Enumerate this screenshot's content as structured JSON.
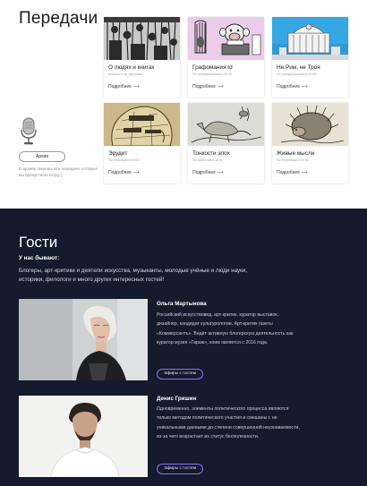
{
  "shows": {
    "title": "Передачи",
    "archive_label": "Архив",
    "archive_note": "В архиве пишешь все передачи, которые вы пропустили! Enjoy:)",
    "cards": [
      {
        "name": "О людях и книгах",
        "meta": "Анонсы и пр. выпусков",
        "more": "Подробнее ⟶",
        "icon": "crowd-engraving"
      },
      {
        "name": "Графомания td",
        "meta": "По понедельникам в 20:00",
        "more": "Подробнее ⟶",
        "icon": "monkey-typewriter"
      },
      {
        "name": "Не Рим, не Троя",
        "meta": "По понедельникам в 20:00",
        "more": "Подробнее ⟶",
        "icon": "roman-ruins"
      },
      {
        "name": "Эрудит",
        "meta": "По пятницам в 00:00",
        "more": "Подробнее ⟶",
        "icon": "phrenology-head"
      },
      {
        "name": "Тонкости эпох",
        "meta": "По субботам в 18:00",
        "more": "Подробнее ⟶",
        "icon": "fox-and-bird"
      },
      {
        "name": "Живые мысли",
        "meta": "По вторникам в 20:00",
        "more": "Подробнее ⟶",
        "icon": "hedgehog-engraving"
      }
    ]
  },
  "guests": {
    "title": "Гости",
    "subtitle": "У нас бывают:",
    "description": "Блогеры, арт-критики и деятели искусства, музыканты, молодые учёные и люди науки, историки, филологи и много других интересных гостей!",
    "people": [
      {
        "name": "Ольга Мартынова",
        "bio": "Российский искусствовед, арт-критик, куратор выставок, дизайнер, кандидат культурологии. Арт-критик газеты «Коммерсантъ». Ведёт активную блогерскую деятельность как куратор музея «Гараж», коим является с 2016 года.",
        "button": "Эфиры с гостем"
      },
      {
        "name": "Денис Гришин",
        "bio": "Одновременно, элементы политического процесса являются только методом политического участия и смешаны с не уникальными данными до степени совершенной неузнаваемости, из-за чего возрастает их статус бесполезности.",
        "button": "Эфиры с гостем"
      }
    ]
  },
  "colors": {
    "dark_bg": "#141b2d",
    "accent_button_border": "#8d73ff"
  }
}
